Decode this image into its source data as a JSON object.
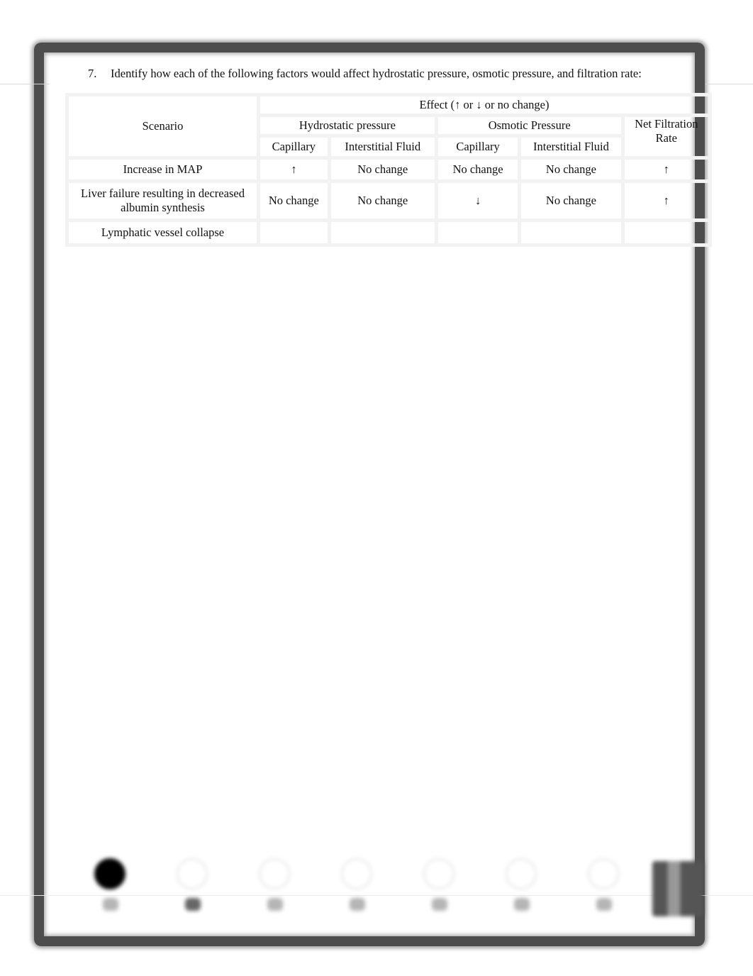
{
  "question": {
    "number": "7.",
    "text": "Identify how each of the following factors would affect hydrostatic pressure, osmotic pressure, and filtration rate:"
  },
  "table": {
    "scenario_header": "Scenario",
    "effect_header": "Effect (↑ or ↓ or no change)",
    "groups": {
      "hydrostatic": "Hydrostatic pressure",
      "osmotic": "Osmotic Pressure",
      "nfr": "Net Filtration Rate"
    },
    "subheaders": {
      "hydro_capillary": "Capillary",
      "hydro_interstitial": "Interstitial Fluid",
      "osm_capillary": "Capillary",
      "osm_interstitial": "Interstitial Fluid"
    },
    "rows": [
      {
        "scenario": "Increase in MAP",
        "hydro_capillary": "↑",
        "hydro_interstitial": "No change",
        "osm_capillary": "No change",
        "osm_interstitial": "No change",
        "nfr": "↑"
      },
      {
        "scenario": "Liver failure resulting in decreased albumin synthesis",
        "hydro_capillary": "No change",
        "hydro_interstitial": "No change",
        "osm_capillary": "↓",
        "osm_interstitial": "No change",
        "nfr": "↑"
      },
      {
        "scenario": "Lymphatic vessel collapse",
        "hydro_capillary": "",
        "hydro_interstitial": "",
        "osm_capillary": "",
        "osm_interstitial": "",
        "nfr": ""
      }
    ]
  },
  "footer_icons": [
    {
      "name": "icon-1",
      "state": "filled"
    },
    {
      "name": "icon-2",
      "state": "outline"
    },
    {
      "name": "icon-3",
      "state": "outline"
    },
    {
      "name": "icon-4",
      "state": "outline"
    },
    {
      "name": "icon-5",
      "state": "outline"
    },
    {
      "name": "icon-6",
      "state": "outline"
    },
    {
      "name": "icon-7",
      "state": "outline"
    },
    {
      "name": "qr-code",
      "state": "block"
    }
  ]
}
